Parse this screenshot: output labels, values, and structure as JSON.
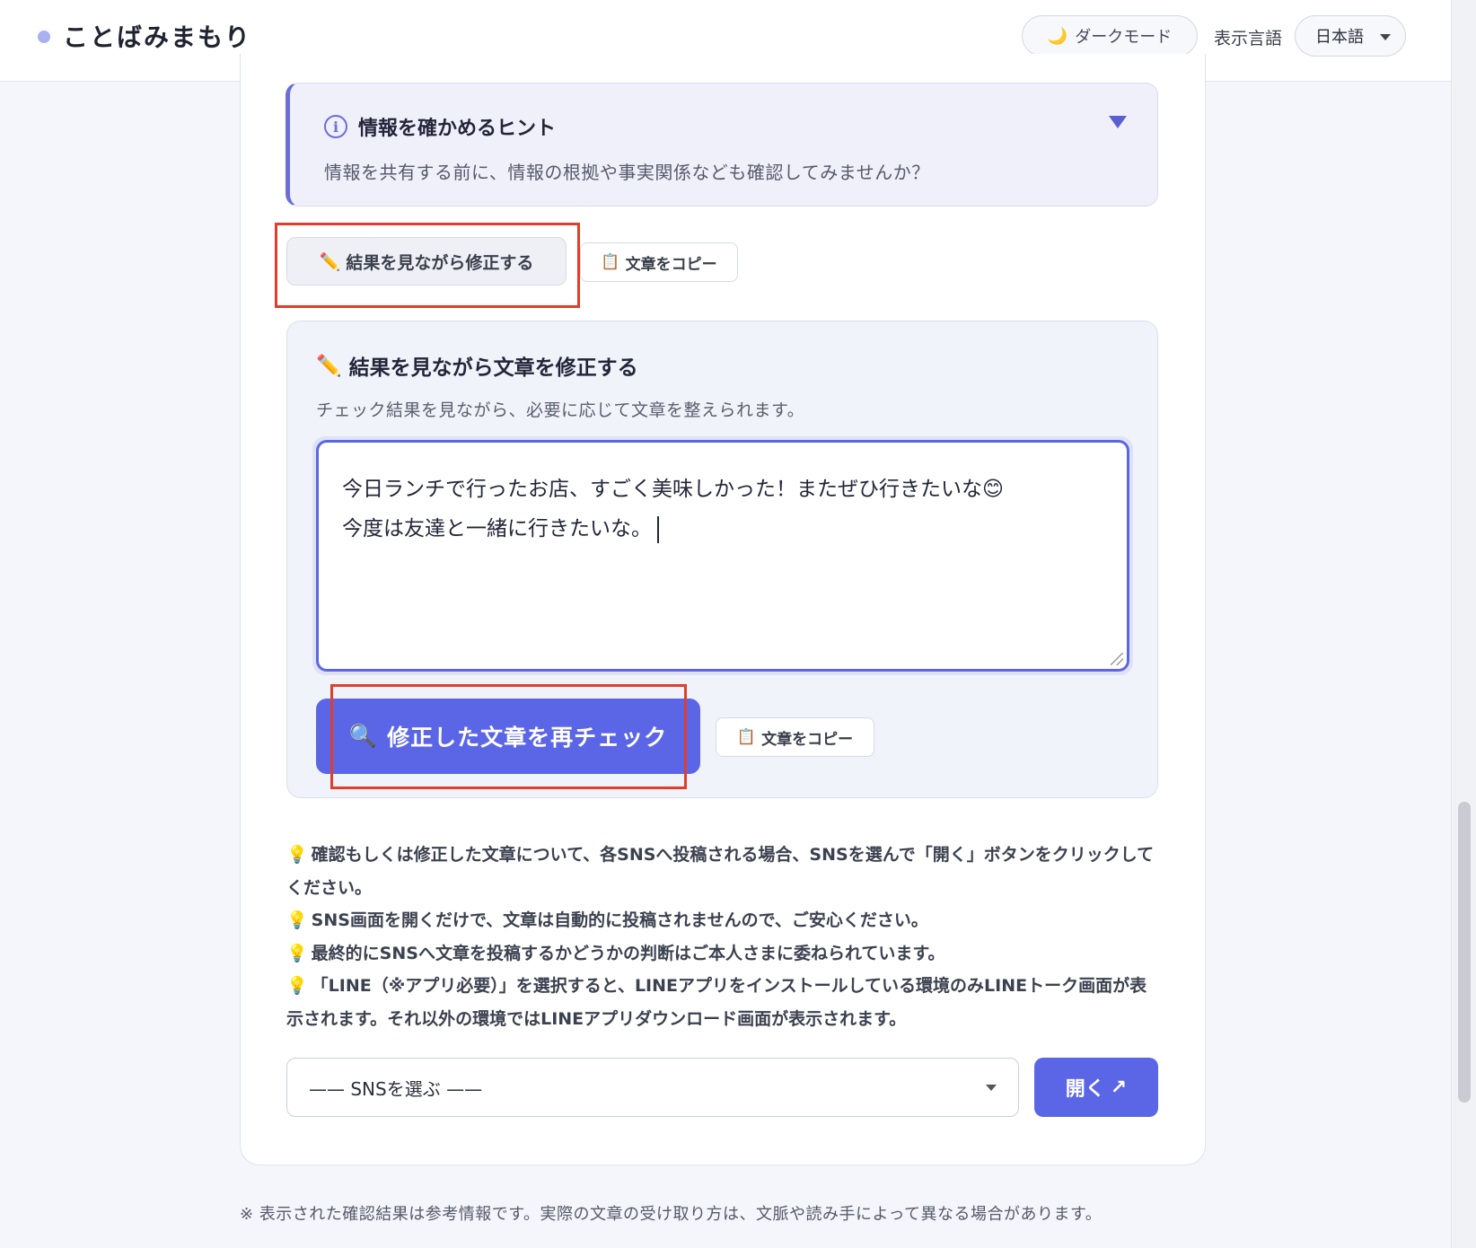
{
  "header": {
    "brand": "ことばみまもり",
    "dark_mode_icon": "🌙",
    "dark_mode_label": "ダークモード",
    "language_label": "表示言語",
    "language_value": "日本語"
  },
  "hint": {
    "title": "情報を確かめるヒント",
    "text": "情報を共有する前に、情報の根拠や事実関係なども確認してみませんか？"
  },
  "actions": {
    "edit_icon": "✏️",
    "edit_label": "結果を見ながら修正する",
    "copy_icon": "📋",
    "copy_label": "文章をコピー"
  },
  "editor": {
    "title_icon": "✏️",
    "title": "結果を見ながら文章を修正する",
    "description": "チェック結果を見ながら、必要に応じて文章を整えられます。",
    "line1": "今日ランチで行ったお店、すごく美味しかった！またぜひ行きたいな😊",
    "line2": "今度は友達と一緒に行きたいな。",
    "recheck_icon": "🔍",
    "recheck_label": "修正した文章を再チェック",
    "copy_icon": "📋",
    "copy_label": "文章をコピー"
  },
  "notes": {
    "bulb": "💡",
    "n1": "確認もしくは修正した文章について、各SNSへ投稿される場合、SNSを選んで「開く」ボタンをクリックしてください。",
    "n2": "SNS画面を開くだけで、文章は自動的に投稿されませんので、ご安心ください。",
    "n3": "最終的にSNSへ文章を投稿するかどうかの判断はご本人さまに委ねられています。",
    "n4": "「LINE（※アプリ必要）」を選択すると、LINEアプリをインストールしている環境のみLINEトーク画面が表示されます。それ以外の環境ではLINEアプリダウンロード画面が表示されます。"
  },
  "sns": {
    "select_value": "—— SNSを選ぶ ——",
    "open_label": "開く",
    "open_icon": "↗"
  },
  "footer": {
    "note": "※ 表示された確認結果は参考情報です。実際の文章の受け取り方は、文脈や読み手によって異なる場合があります。"
  },
  "colors": {
    "accent": "#5b66e6",
    "highlight": "#e13c2c"
  }
}
